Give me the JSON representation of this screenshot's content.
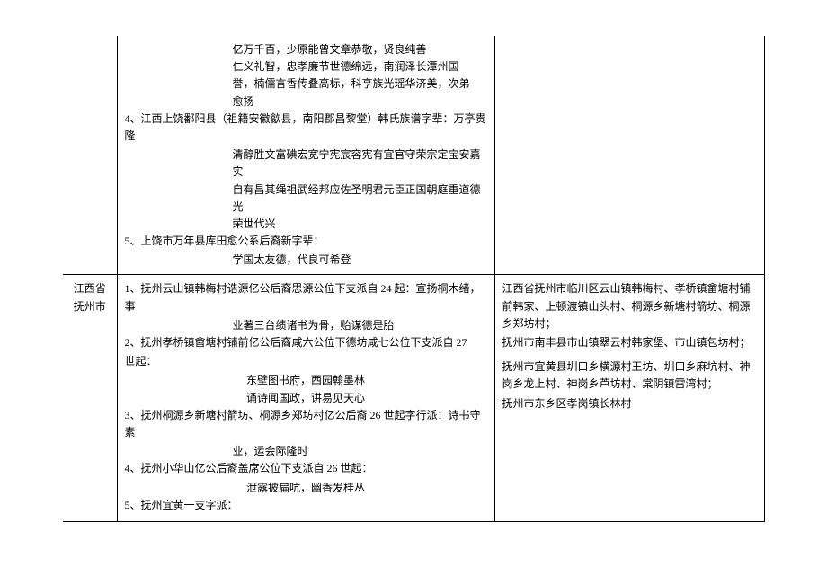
{
  "row1": {
    "middle": {
      "indent_lines": [
        "亿万千百，少原能曾文章恭敬，贤良纯善",
        "仁义礼智，忠孝廉节世德绵远，南润泽长潭州国",
        "誉，楠儒言香传叠高标，科亨族光瑶华济美，次弟",
        "愈扬"
      ],
      "entry4_head": "4、江西上饶鄱阳县（祖籍安徽歙县，南阳郡昌黎堂）韩氏族谱字辈：万亭贵隆",
      "entry4_lines": [
        "清醇胜文富碘宏宽宁宪宸容宪有宜官守荣宗定宝安嘉实",
        "自有昌其绳祖武经邦应佐圣明君元臣正国朝庭重道德光",
        "荣世代兴"
      ],
      "entry5_head": "5、上饶市万年县库田愈公系后裔新字辈：",
      "entry5_line": "学国太友德，代良可希登"
    },
    "right": ""
  },
  "row2": {
    "label_line1": "江西省",
    "label_line2": "抚州市",
    "middle": {
      "entry1_head": "1、抚州云山镇韩梅村诰源亿公后裔思源公位下支派自 24 起：宣扬桐木绪，事",
      "entry1_line": "业著三台绩诸书为骨，贻谋德是胎",
      "entry2_head": "2、抚州孝桥镇畲塘村铺前亿公后裔咸六公位下德坊咸七公位下支派自 27",
      "entry2_head2": "世起：",
      "entry2_center1": "东壁图书府，西园翰墨林",
      "entry2_center2": "诵诗闻国政，讲易见天心",
      "entry3_head": "3、抚州桐源乡新塘村箭坊、桐源乡郑坊村亿公后裔 26 世起字行派：诗书守素",
      "entry3_line": "业，运会际隆时",
      "entry4_head": "4、抚州小华山亿公后裔盖席公位下支派自 26 世起：",
      "entry4_center": "泄露披扁吭，幽香发桂丛",
      "entry5_head": "5、抚州宜黄一支字派："
    },
    "right": {
      "p1": "江西省抚州市临川区云山镇韩梅村、孝桥镇畲塘村铺前韩家、上顿渡镇山头村、桐源乡新塘村箭坊、桐源乡郑坊村；",
      "p2": "抚州市南丰县市山镇翠云村韩家堡、市山镇包坊村；",
      "p3": "抚州市宜黄县圳口乡横源村王坊、圳口乡麻坑村、神岗乡龙上村、神岗乡芦坊村、棠阴镇雷湾村；",
      "p4": "抚州市东乡区孝岗镇长林村"
    }
  }
}
